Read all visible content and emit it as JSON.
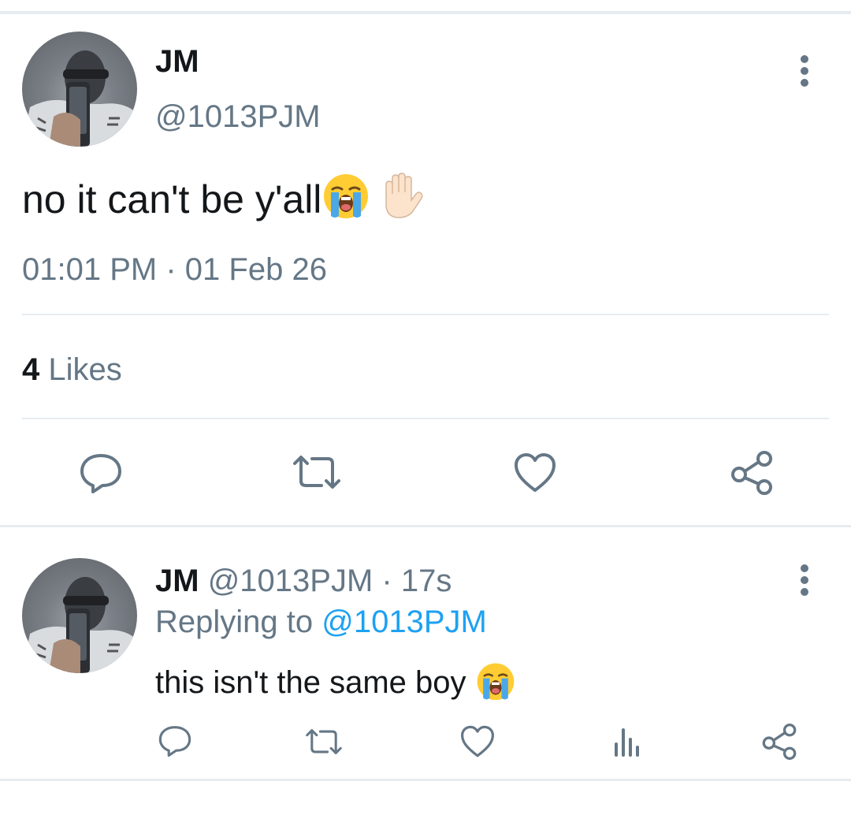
{
  "main_tweet": {
    "display_name": "JM",
    "handle": "@1013PJM",
    "text": "no it can't be y'all",
    "time": "01:01 PM",
    "separator": "·",
    "date": "01 Feb 26",
    "likes_count": "4",
    "likes_label": "Likes",
    "emojis": [
      "loudly-crying-face",
      "raised-hand"
    ],
    "actions": [
      "reply-icon",
      "retweet-icon",
      "like-icon",
      "share-icon"
    ]
  },
  "reply_tweet": {
    "display_name": "JM",
    "handle": "@1013PJM",
    "separator": "·",
    "age": "17s",
    "replying_prefix": "Replying to",
    "replying_to": "@1013PJM",
    "text": "this isn't the same boy",
    "emojis": [
      "loudly-crying-face"
    ],
    "actions": [
      "reply-icon",
      "retweet-icon",
      "like-icon",
      "analytics-icon",
      "share-icon"
    ]
  },
  "colors": {
    "text_primary": "#14171a",
    "text_secondary": "#657786",
    "link": "#1da1f2",
    "divider": "#e6ecf0"
  }
}
